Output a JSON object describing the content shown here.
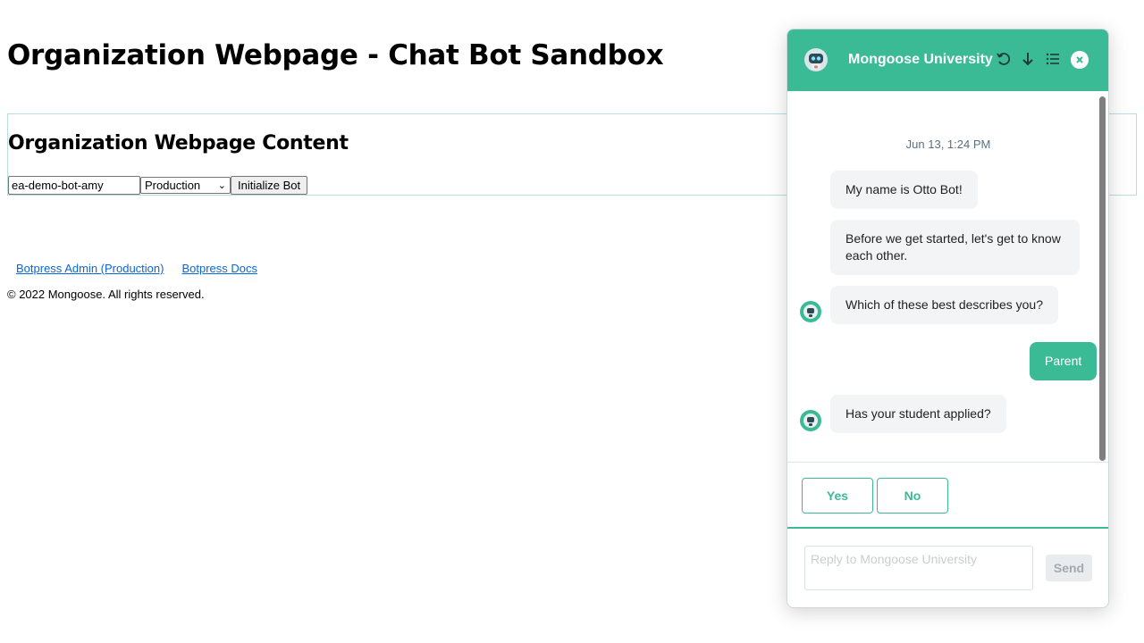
{
  "page": {
    "title": "Organization Webpage - Chat Bot Sandbox",
    "content_title": "Organization Webpage Content",
    "bot_id_value": "ea-demo-bot-amy",
    "environment_selected": "Production",
    "init_button": "Initialize Bot",
    "links": {
      "admin": "Botpress Admin (Production)",
      "docs": "Botpress Docs"
    },
    "copyright": "© 2022 Mongoose. All rights reserved."
  },
  "chat": {
    "title": "Mongoose University",
    "accent_color": "#3bba96",
    "header_icons": [
      "refresh-icon",
      "download-icon",
      "list-icon",
      "close-icon"
    ],
    "date_separator": "Jun 13, 1:24 PM",
    "messages": [
      {
        "from": "bot",
        "text": "My name is Otto Bot!"
      },
      {
        "from": "bot",
        "text": "Before we get started, let's get to know each other."
      },
      {
        "from": "bot",
        "text": "Which of these best describes you?"
      },
      {
        "from": "user",
        "text": "Parent"
      },
      {
        "from": "bot",
        "text": "Has your student applied?"
      }
    ],
    "quick_replies": [
      "Yes",
      "No"
    ],
    "composer_placeholder": "Reply to Mongoose University",
    "send_label": "Send"
  }
}
